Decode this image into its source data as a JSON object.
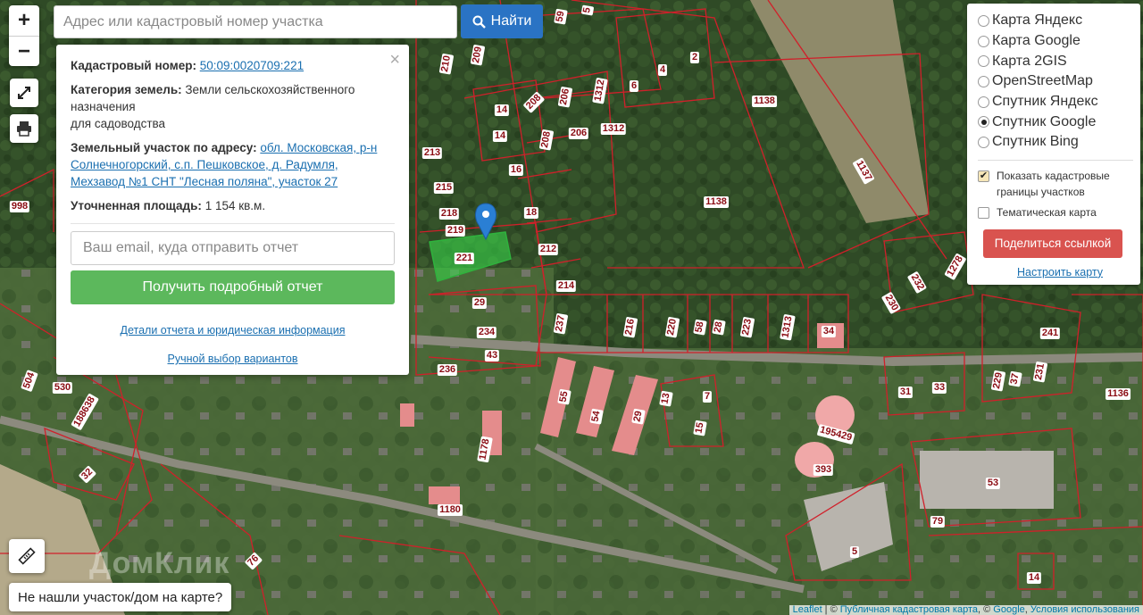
{
  "search": {
    "placeholder": "Адрес или кадастровый номер участка",
    "button_label": "Найти"
  },
  "zoom": {
    "in": "+",
    "out": "−"
  },
  "info": {
    "cadastral_label": "Кадастровый номер:",
    "cadastral_value": "50:09:0020709:221",
    "category_label": "Категория земель:",
    "category_value_1": "Земли сельскохозяйственного назначения",
    "category_value_2": "для садоводства",
    "address_label": "Земельный участок по адресу:",
    "address_value": "обл. Московская, р-н Солнечногорский, с.п. Пешковское, д. Радумля, Мехзавод №1 СНТ \"Лесная поляна\", участок 27",
    "area_label": "Уточненная площадь:",
    "area_value": "1 154 кв.м.",
    "email_placeholder": "Ваш email, куда отправить отчет",
    "report_button": "Получить подробный отчет",
    "details_link": "Детали отчета и юридическая информация",
    "manual_link": "Ручной выбор вариантов",
    "close": "×"
  },
  "layers": {
    "items": [
      {
        "label": "Карта Яндекс",
        "selected": false
      },
      {
        "label": "Карта Google",
        "selected": false
      },
      {
        "label": "Карта 2GIS",
        "selected": false
      },
      {
        "label": "OpenStreetMap",
        "selected": false
      },
      {
        "label": "Спутник Яндекс",
        "selected": false
      },
      {
        "label": "Спутник Google",
        "selected": true
      },
      {
        "label": "Спутник Bing",
        "selected": false
      }
    ],
    "show_borders_label": "Показать кадастровые границы участков",
    "show_borders_checked": true,
    "thematic_label": "Тематическая карта",
    "thematic_checked": false,
    "share_button": "Поделиться ссылкой",
    "configure_link": "Настроить карту"
  },
  "bottom": {
    "not_found": "Не нашли участок/дом на карте?",
    "attribution_leaflet": "Leaflet",
    "attribution_pkk": "Публичная кадастровая карта",
    "attribution_google": "Google",
    "attribution_terms": "Условия использования"
  },
  "map_labels": [
    "210",
    "209",
    "59",
    "5",
    "2",
    "4",
    "6",
    "1312",
    "1312",
    "206",
    "206",
    "208",
    "208",
    "14",
    "14",
    "16",
    "18",
    "213",
    "215",
    "218",
    "219",
    "221",
    "212",
    "214",
    "29",
    "234",
    "43",
    "236",
    "237",
    "216",
    "220",
    "58",
    "28",
    "223",
    "1313",
    "34",
    "1138",
    "1138",
    "1137",
    "998",
    "1278",
    "232",
    "230",
    "241",
    "229",
    "37",
    "231",
    "31",
    "33",
    "1136",
    "55",
    "54",
    "29",
    "13",
    "7",
    "15",
    "195429",
    "393",
    "1178",
    "1180",
    "32",
    "76",
    "504",
    "530",
    "188638",
    "53",
    "79",
    "5",
    "14"
  ],
  "colors": {
    "parcel_border": "#d0202a",
    "selected_parcel": "#33cc44",
    "marker": "#2a7fd4",
    "primary_button": "#2a73c4",
    "report_button": "#5cb85c",
    "share_button": "#d9534f",
    "link": "#1a6fb0"
  }
}
